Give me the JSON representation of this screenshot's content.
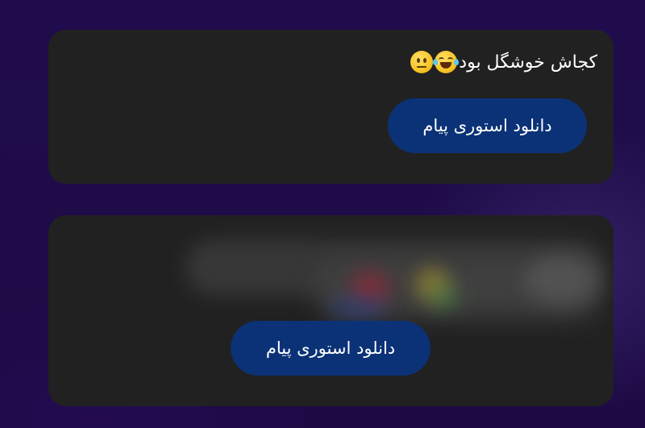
{
  "messages": [
    {
      "text": "کجاش خوشگل بود",
      "emojis": [
        "face-with-tears-of-joy",
        "neutral-face"
      ],
      "button_label": "دانلود استوری پیام"
    },
    {
      "media": "blurred-image",
      "button_label": "دانلود استوری پیام"
    }
  ],
  "colors": {
    "background": "#1e0b48",
    "card": "#212121",
    "button": "#0b3277",
    "text": "#ffffff"
  }
}
